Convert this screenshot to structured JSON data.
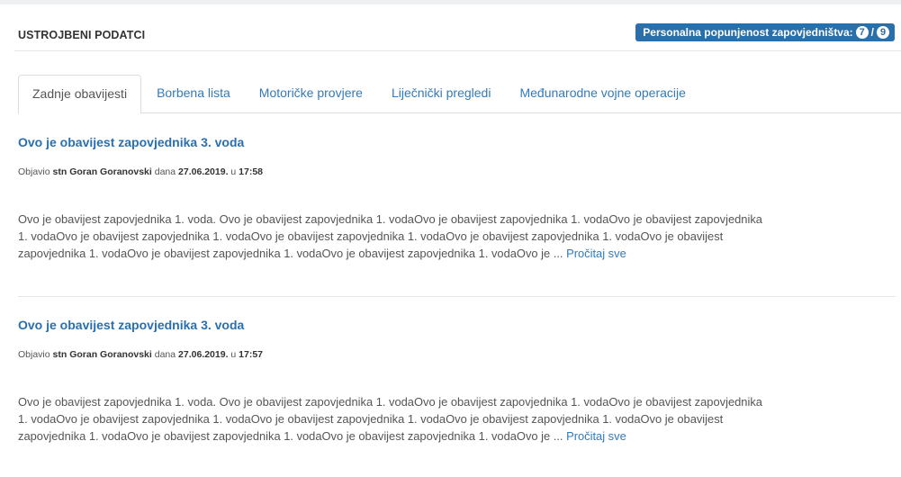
{
  "panel": {
    "title": "USTROJBENI PODATCI",
    "staffing_label": "Personalna popunjenost zapovjedništva:",
    "staffing_current": "7",
    "staffing_separator": "/",
    "staffing_total": "9"
  },
  "tabs": [
    {
      "label": "Zadnje obavijesti",
      "active": true
    },
    {
      "label": "Borbena lista",
      "active": false
    },
    {
      "label": "Motoričke provjere",
      "active": false
    },
    {
      "label": "Liječnički pregledi",
      "active": false
    },
    {
      "label": "Međunarodne vojne operacije",
      "active": false
    }
  ],
  "posts": [
    {
      "title": "Ovo je obavijest zapovjednika 3. voda",
      "meta_prefix": "Objavio",
      "author": "stn Goran Goranovski",
      "meta_date_prefix": "dana",
      "date": "27.06.2019.",
      "meta_time_prefix": "u",
      "time": "17:58",
      "body_lines": [
        "Ovo je obavijest zapovjednika 1. voda. Ovo je obavijest zapovjednika 1. vodaOvo je obavijest zapovjednika 1. vodaOvo je obavijest zapovjednika",
        "1. vodaOvo je obavijest zapovjednika 1. vodaOvo je obavijest zapovjednika 1. vodaOvo je obavijest zapovjednika 1. vodaOvo je obavijest",
        "zapovjednika 1. vodaOvo je obavijest zapovjednika 1. vodaOvo je obavijest zapovjednika 1. vodaOvo je ..."
      ],
      "read_more": "Pročitaj sve"
    },
    {
      "title": "Ovo je obavijest zapovjednika 3. voda",
      "meta_prefix": "Objavio",
      "author": "stn Goran Goranovski",
      "meta_date_prefix": "dana",
      "date": "27.06.2019.",
      "meta_time_prefix": "u",
      "time": "17:57",
      "body_lines": [
        "Ovo je obavijest zapovjednika 1. voda. Ovo je obavijest zapovjednika 1. vodaOvo je obavijest zapovjednika 1. vodaOvo je obavijest zapovjednika",
        "1. vodaOvo je obavijest zapovjednika 1. vodaOvo je obavijest zapovjednika 1. vodaOvo je obavijest zapovjednika 1. vodaOvo je obavijest",
        "zapovjednika 1. vodaOvo je obavijest zapovjednika 1. vodaOvo je obavijest zapovjednika 1. vodaOvo je ..."
      ],
      "read_more": "Pročitaj sve"
    }
  ],
  "colors": {
    "link": "#337ab7",
    "title_link": "#2a6fae",
    "badge_bg": "#2b6fa8",
    "text": "#555555"
  }
}
